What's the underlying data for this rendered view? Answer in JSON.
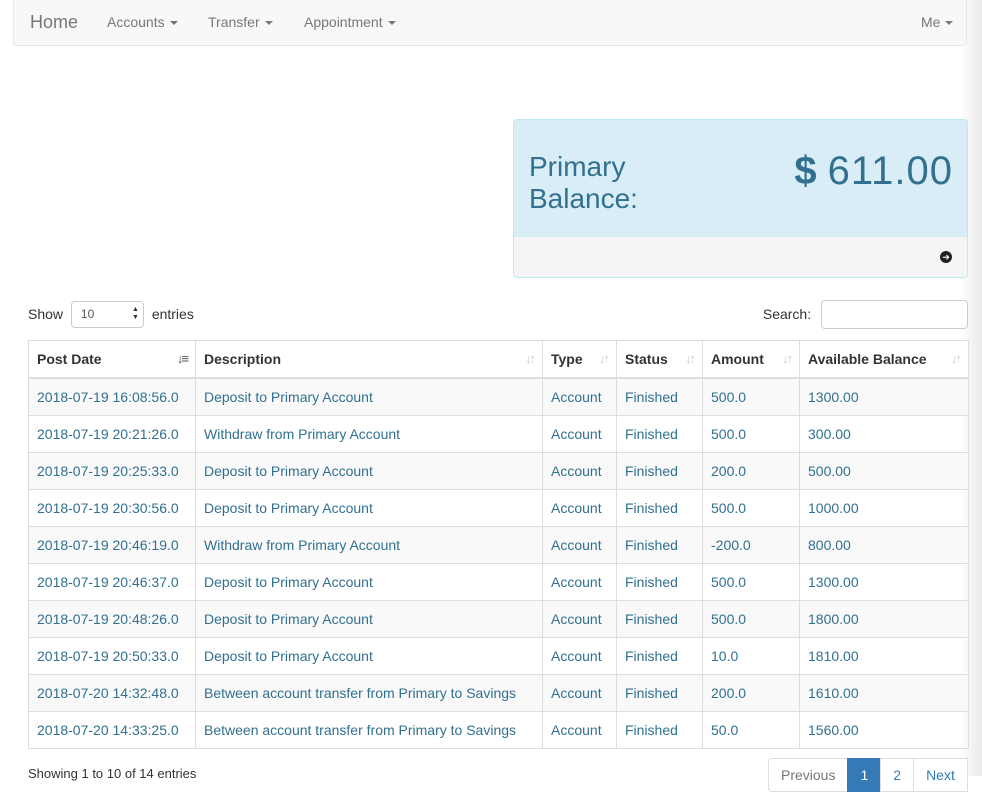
{
  "navbar": {
    "brand": "Home",
    "accounts": "Accounts",
    "transfer": "Transfer",
    "appointment": "Appointment",
    "me": "Me"
  },
  "balance_panel": {
    "title": "Primary Balance:",
    "currency_symbol": "$",
    "amount": "611.00",
    "footer_icon": "arrow-circle-right-icon"
  },
  "table_controls": {
    "show_label": "Show",
    "entries_value": "10",
    "entries_label": "entries",
    "search_label": "Search:",
    "search_value": ""
  },
  "table": {
    "headers": [
      "Post Date",
      "Description",
      "Type",
      "Status",
      "Amount",
      "Available Balance"
    ],
    "rows": [
      [
        "2018-07-19 16:08:56.0",
        "Deposit to Primary Account",
        "Account",
        "Finished",
        "500.0",
        "1300.00"
      ],
      [
        "2018-07-19 20:21:26.0",
        "Withdraw from Primary Account",
        "Account",
        "Finished",
        "500.0",
        "300.00"
      ],
      [
        "2018-07-19 20:25:33.0",
        "Deposit to Primary Account",
        "Account",
        "Finished",
        "200.0",
        "500.00"
      ],
      [
        "2018-07-19 20:30:56.0",
        "Deposit to Primary Account",
        "Account",
        "Finished",
        "500.0",
        "1000.00"
      ],
      [
        "2018-07-19 20:46:19.0",
        "Withdraw from Primary Account",
        "Account",
        "Finished",
        "-200.0",
        "800.00"
      ],
      [
        "2018-07-19 20:46:37.0",
        "Deposit to Primary Account",
        "Account",
        "Finished",
        "500.0",
        "1300.00"
      ],
      [
        "2018-07-19 20:48:26.0",
        "Deposit to Primary Account",
        "Account",
        "Finished",
        "500.0",
        "1800.00"
      ],
      [
        "2018-07-19 20:50:33.0",
        "Deposit to Primary Account",
        "Account",
        "Finished",
        "10.0",
        "1810.00"
      ],
      [
        "2018-07-20 14:32:48.0",
        "Between account transfer from Primary to Savings",
        "Account",
        "Finished",
        "200.0",
        "1610.00"
      ],
      [
        "2018-07-20 14:33:25.0",
        "Between account transfer from Primary to Savings",
        "Account",
        "Finished",
        "50.0",
        "1560.00"
      ]
    ]
  },
  "footer": {
    "info": "Showing 1 to 10 of 14 entries",
    "pagination": [
      "Previous",
      "1",
      "2",
      "Next"
    ],
    "active_page": "1"
  },
  "colors": {
    "panel_bg": "#d9edf7",
    "panel_text": "#31708f",
    "cell_text": "#31708f",
    "active_page_bg": "#337ab7"
  }
}
